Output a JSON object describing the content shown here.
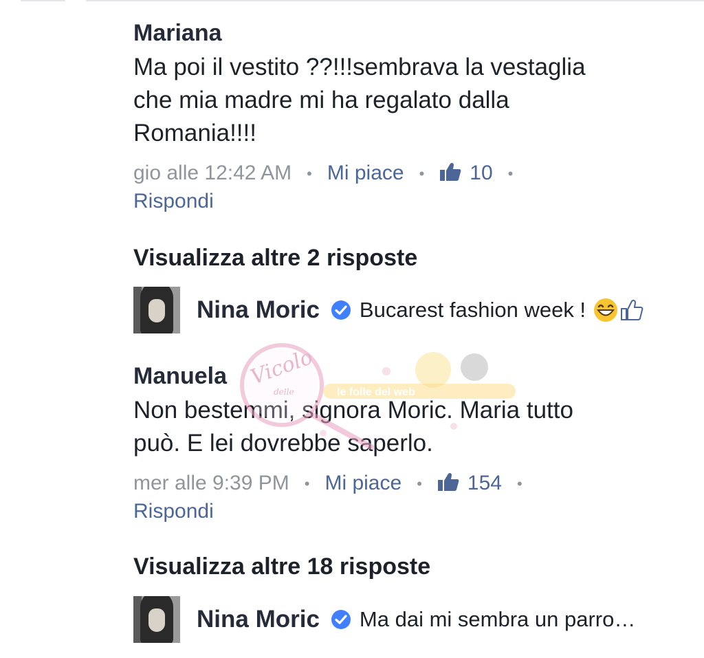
{
  "comments": [
    {
      "author": "Mariana",
      "text_lines": [
        "Ma poi il vestito ??!!!sembrava la vestaglia",
        "che mia madre mi ha regalato dalla",
        "Romania!!!!"
      ],
      "timestamp": "gio alle 12:42 AM",
      "like_label": "Mi piace",
      "like_count": "10",
      "reply_label": "Rispondi",
      "more_replies": "Visualizza altre 2 risposte",
      "reply_preview": {
        "author": "Nina Moric",
        "text": "Bucarest fashion week !"
      }
    },
    {
      "author": "Manuela",
      "text_lines": [
        "Non bestemmi, signora Moric. Maria tutto",
        "può. E lei dovrebbe saperlo."
      ],
      "timestamp": "mer alle 9:39 PM",
      "like_label": "Mi piace",
      "like_count": "154",
      "reply_label": "Rispondi",
      "more_replies": "Visualizza altre 18 risposte",
      "reply_preview": {
        "author": "Nina Moric",
        "text": "Ma dai mi sembra un parro…"
      }
    }
  ],
  "separator": "•",
  "icons": {
    "like": "thumbs-up-icon",
    "verified": "verified-badge-icon",
    "emoji": "grinning-face-icon",
    "thumb_outline": "thumbs-up-outline-icon"
  },
  "colors": {
    "link": "#4b6697",
    "meta": "#90949c",
    "text": "#1d2129",
    "verified": "#4080ff"
  },
  "watermark": {
    "text_main": "Vicolo",
    "text_small": "delle",
    "text_banner": "le folle del web"
  }
}
